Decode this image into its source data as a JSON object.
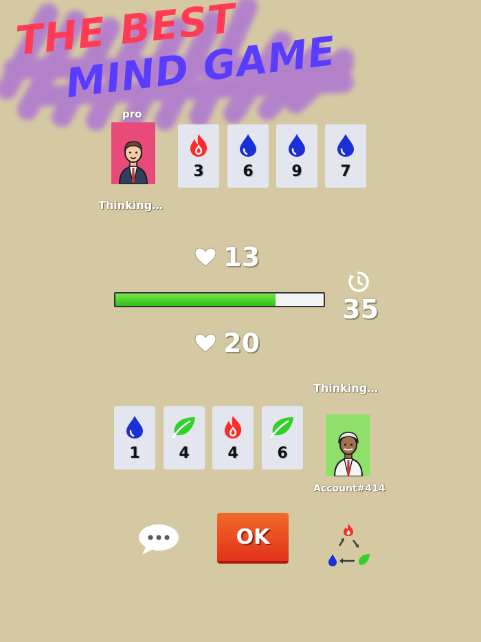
{
  "banner": {
    "line1": "THE BEST",
    "line2": "MIND GAME"
  },
  "colors": {
    "fire": "#ff2a2a",
    "water": "#1a2fd6",
    "leaf": "#2fd12a",
    "opponent_bg": "#e84a7a",
    "player_bg": "#8fe06a"
  },
  "opponent": {
    "name": "pro",
    "status": "Thinking…",
    "hp": "13",
    "cards": [
      {
        "element": "fire",
        "value": "3"
      },
      {
        "element": "water",
        "value": "6"
      },
      {
        "element": "water",
        "value": "9"
      },
      {
        "element": "water",
        "value": "7"
      }
    ]
  },
  "timer": {
    "value": "35",
    "progress": 0.77
  },
  "player": {
    "name": "Account#414",
    "status": "Thinking…",
    "hp": "20",
    "cards": [
      {
        "element": "water",
        "value": "1"
      },
      {
        "element": "leaf",
        "value": "4"
      },
      {
        "element": "fire",
        "value": "4"
      },
      {
        "element": "leaf",
        "value": "6"
      }
    ]
  },
  "controls": {
    "ok_label": "OK",
    "chat_icon": "chat-bubble-icon",
    "cycle_icon": "element-cycle-icon"
  }
}
